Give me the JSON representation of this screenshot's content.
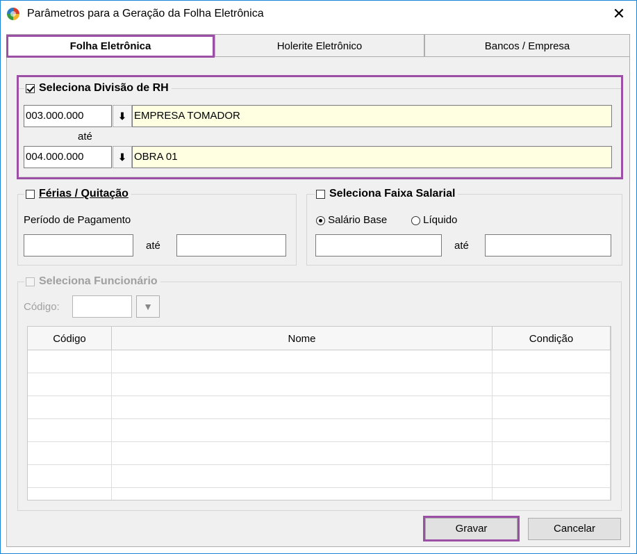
{
  "window": {
    "title": "Parâmetros para a Geração da Folha Eletrônica",
    "close_glyph": "✕"
  },
  "tabs": [
    {
      "label": "Folha Eletrônica",
      "active": true
    },
    {
      "label": "Holerite Eletrônico",
      "active": false
    },
    {
      "label": "Bancos / Empresa",
      "active": false
    }
  ],
  "divisao": {
    "legend": "Seleciona Divisão de RH",
    "checked": true,
    "from_code": "003.000.000",
    "from_name": "EMPRESA TOMADOR",
    "to_label": "até",
    "to_code": "004.000.000",
    "to_name": "OBRA 01"
  },
  "ferias": {
    "legend": "Férias / Quitação",
    "checked": false,
    "period_label": "Período de Pagamento",
    "to_label": "até",
    "start_value": "",
    "end_value": ""
  },
  "faixa": {
    "legend": "Seleciona Faixa Salarial",
    "checked": false,
    "radio_salario": "Salário Base",
    "radio_liquido": "Líquido",
    "selected": "Salário Base",
    "to_label": "até",
    "start_value": "",
    "end_value": ""
  },
  "funcionario": {
    "legend": "Seleciona Funcionário",
    "checked": false,
    "code_label": "Código:",
    "code_value": "",
    "columns": [
      "Código",
      "Nome",
      "Condição"
    ],
    "rows": [
      [
        "",
        "",
        ""
      ],
      [
        "",
        "",
        ""
      ],
      [
        "",
        "",
        ""
      ],
      [
        "",
        "",
        ""
      ],
      [
        "",
        "",
        ""
      ],
      [
        "",
        "",
        ""
      ],
      [
        "",
        "",
        ""
      ]
    ]
  },
  "buttons": {
    "save": "Gravar",
    "cancel": "Cancelar"
  },
  "colors": {
    "highlight": "#9b4fa5",
    "field_yellow": "#ffffe1",
    "panel_bg": "#f0f0f0"
  }
}
